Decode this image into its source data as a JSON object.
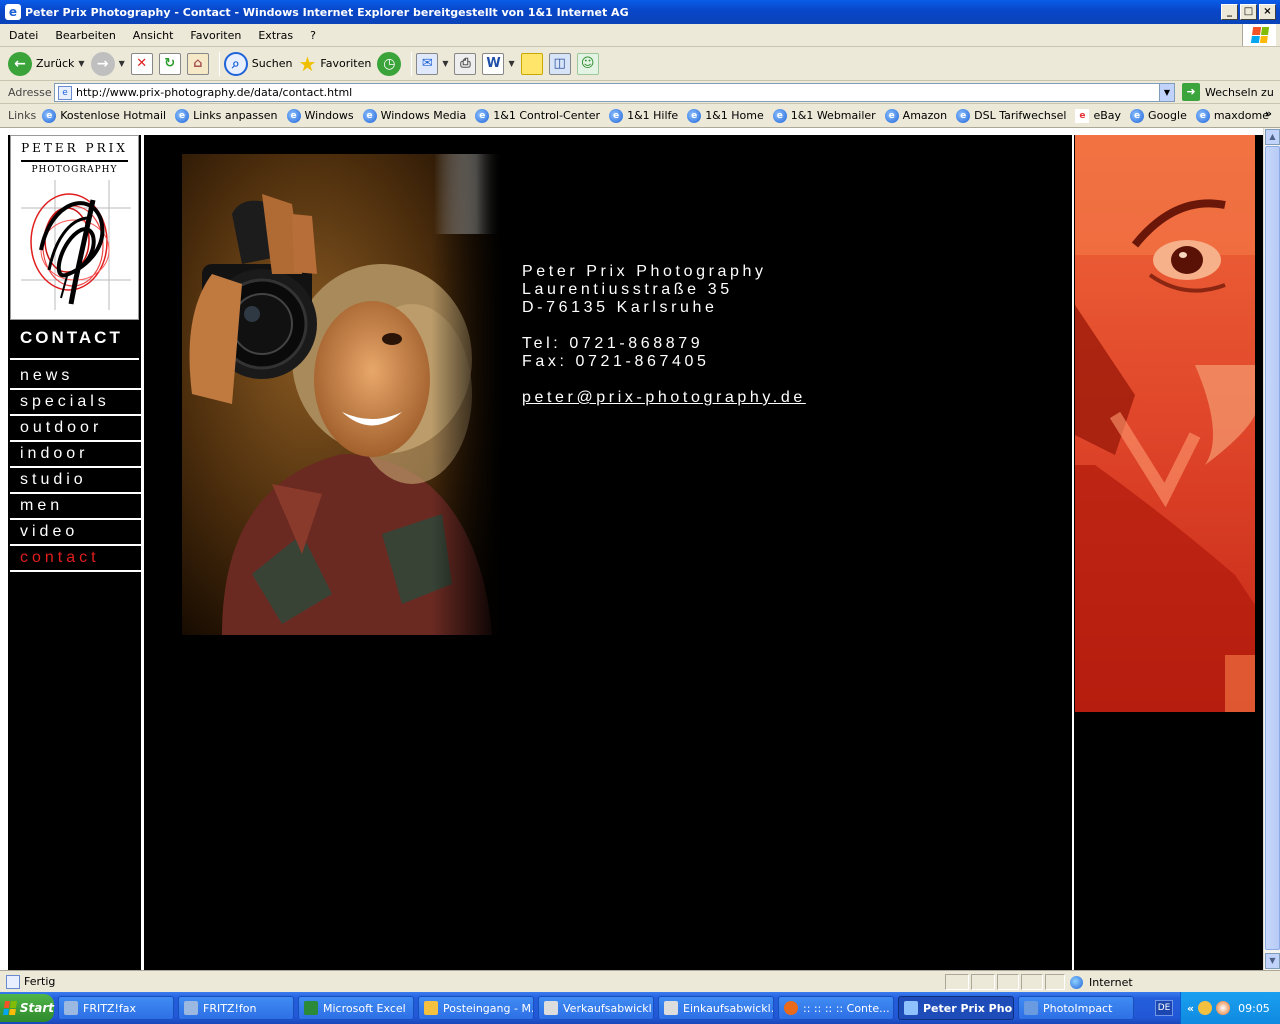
{
  "window": {
    "title": "Peter Prix Photography - Contact - Windows Internet Explorer bereitgestellt von 1&1 Internet AG"
  },
  "menu": [
    "Datei",
    "Bearbeiten",
    "Ansicht",
    "Favoriten",
    "Extras",
    "?"
  ],
  "toolbar": {
    "back": "Zurück",
    "search": "Suchen",
    "favorites": "Favoriten"
  },
  "address": {
    "label": "Adresse",
    "url": "http://www.prix-photography.de/data/contact.html",
    "go": "Wechseln zu"
  },
  "links": {
    "label": "Links",
    "items": [
      "Kostenlose Hotmail",
      "Links anpassen",
      "Windows",
      "Windows Media",
      "1&1 Control-Center",
      "1&1 Hilfe",
      "1&1 Home",
      "1&1 Webmailer",
      "Amazon",
      "DSL Tarifwechsel",
      "eBay",
      "Google",
      "maxdome"
    ]
  },
  "site": {
    "logo": {
      "name": "PETER PRIX",
      "sub": "PHOTOGRAPHY"
    },
    "section_title": "CONTACT",
    "nav": [
      "news",
      "specials",
      "outdoor",
      "indoor",
      "studio",
      "men",
      "video",
      "contact"
    ],
    "active_nav": "contact",
    "contact": {
      "name": "Peter Prix Photography",
      "street": "Laurentiusstraße 35",
      "city": "D-76135 Karlsruhe",
      "tel": "Tel: 0721-868879",
      "fax": "Fax: 0721-867405",
      "email": "peter@prix-photography.de"
    }
  },
  "status": {
    "text": "Fertig",
    "zone": "Internet"
  },
  "taskbar": {
    "start": "Start",
    "tasks": [
      "FRITZ!fax",
      "FRITZ!fon",
      "Microsoft Excel",
      "Posteingang - M...",
      "Verkaufsabwickl...",
      "Einkaufsabwickl...",
      ":: :: :: :: Conte...",
      "Peter Prix Pho...",
      "PhotoImpact"
    ],
    "active_task": "Peter Prix Pho...",
    "lang": "DE",
    "time": "09:05"
  },
  "colors": {
    "nav_active": "#e11d1d",
    "site_bg": "#000000",
    "titlebar": "#0a5ce8"
  }
}
